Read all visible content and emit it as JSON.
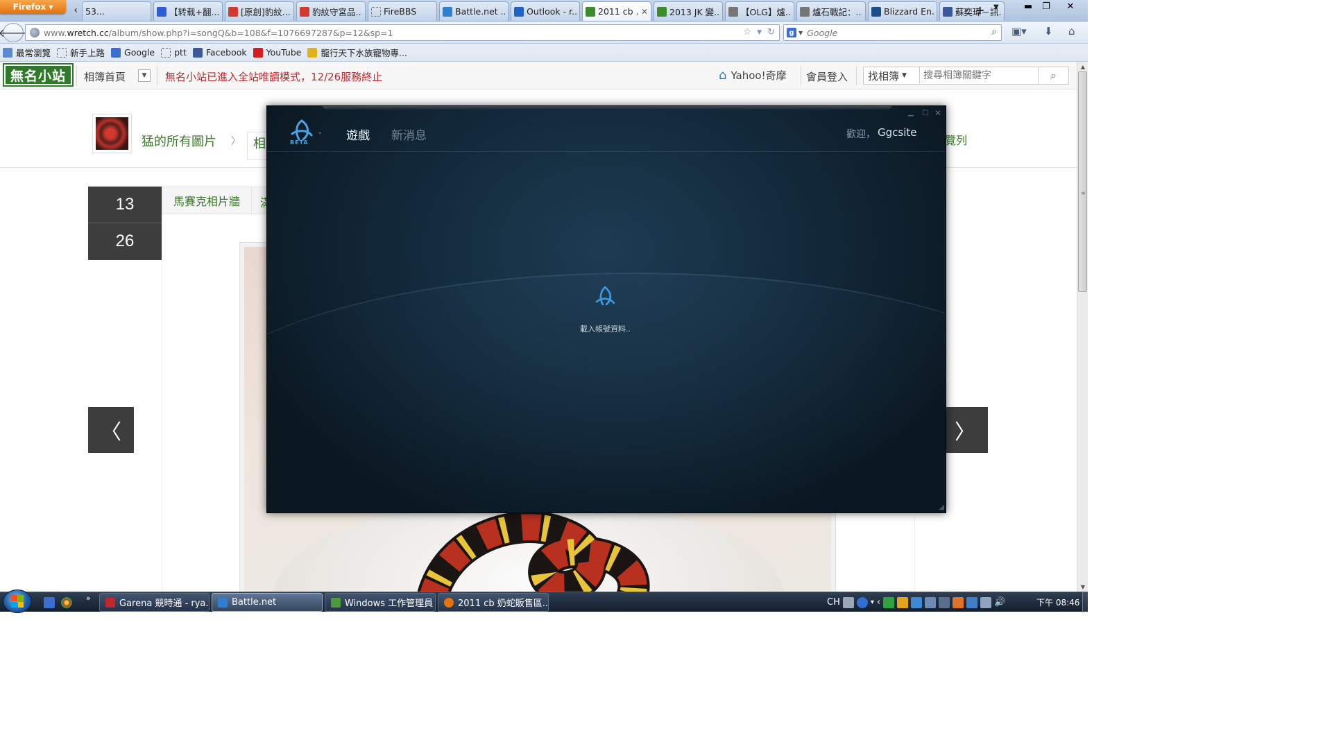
{
  "browser": {
    "app_button": "Firefox",
    "tabs": [
      {
        "label": "53...",
        "icon": "generic-page-icon",
        "color": "#ffffff"
      },
      {
        "label": "【转载+翻...",
        "icon": "baidu-paw-icon",
        "color": "#2f5fd0"
      },
      {
        "label": "[原創]豹紋...",
        "icon": "red-apple-icon",
        "color": "#d23a2f"
      },
      {
        "label": "豹紋守宮品...",
        "icon": "red-apple-icon",
        "color": "#d23a2f"
      },
      {
        "label": "FireBBS",
        "icon": "blank-page-icon",
        "color": "#ffffff"
      },
      {
        "label": "Battle.net ...",
        "icon": "battlenet-icon",
        "color": "#2f7fd0"
      },
      {
        "label": "Outlook - r...",
        "icon": "outlook-icon",
        "color": "#1f62c4"
      },
      {
        "label": "2011 cb ...",
        "icon": "green-album-icon",
        "color": "#3c8a2c",
        "active": true
      },
      {
        "label": "2013 JK 變...",
        "icon": "green-album-icon",
        "color": "#3c8a2c"
      },
      {
        "label": "【OLG】爐...",
        "icon": "bird-icon",
        "color": "#777777"
      },
      {
        "label": "爐石戰記：...",
        "icon": "bird-icon",
        "color": "#777777"
      },
      {
        "label": "Blizzard En...",
        "icon": "blizzard-icon",
        "color": "#1b4f8a"
      },
      {
        "label": "蘇奕瑋－訊...",
        "icon": "facebook-icon",
        "color": "#3b5998"
      }
    ],
    "url": {
      "prefix": "www.",
      "domain": "wretch.cc",
      "path": "/album/show.php?i=songQ&b=108&f=1076697287&p=12&sp=1"
    },
    "search": {
      "engine": "g",
      "placeholder": "Google"
    },
    "bookmarks": [
      {
        "label": "最常瀏覽",
        "icon": "most-visited-icon",
        "color": "#5b8ad0"
      },
      {
        "label": "新手上路",
        "icon": "blank-page-icon",
        "color": ""
      },
      {
        "label": "Google",
        "icon": "google-icon",
        "color": "#3a6fd0"
      },
      {
        "label": "ptt",
        "icon": "blank-page-icon",
        "color": ""
      },
      {
        "label": "Facebook",
        "icon": "facebook-icon",
        "color": "#3b5998"
      },
      {
        "label": "YouTube",
        "icon": "youtube-icon",
        "color": "#d61c1c"
      },
      {
        "label": "龍行天下水族寵物專...",
        "icon": "dragon-icon",
        "color": "#e0b21c"
      }
    ]
  },
  "site": {
    "logo": "無名小站",
    "album_home": "相簿首頁",
    "notice": "無名小站已進入全站唯讀模式，12/26服務終止",
    "yahoo": "Yahoo!奇摩",
    "login": "會員登入",
    "find_album": "找相簿",
    "search_placeholder": "搜尋相簿關鍵字",
    "crumb_all": "猛的所有圖片",
    "crumb_next": "相",
    "crumb_right": "覽列",
    "date_top": "13",
    "date_bottom": "26",
    "album_tab": "馬賽克相片牆",
    "album_tab_cut": "滿"
  },
  "battlenet": {
    "beta_label": "BETA",
    "tab_games": "遊戲",
    "tab_news": "新消息",
    "welcome": "歡迎，",
    "username": "Ggcsite",
    "loading_text": "載入帳號資料..",
    "accent_color": "#4aa3e6"
  },
  "taskbar": {
    "tasks": [
      {
        "label": "Garena 競時通 - rya...",
        "icon": "garena-icon",
        "color": "#c4262e"
      },
      {
        "label": "Battle.net",
        "icon": "battlenet-icon",
        "color": "#2f7fd0",
        "active": true
      },
      {
        "label": "Windows 工作管理員",
        "icon": "task-manager-icon",
        "color": "#4c9a3c"
      },
      {
        "label": "2011 cb 奶蛇販售區...",
        "icon": "firefox-icon",
        "color": "#e2730f"
      }
    ],
    "lang": "CH",
    "clock": "下午 08:46"
  }
}
